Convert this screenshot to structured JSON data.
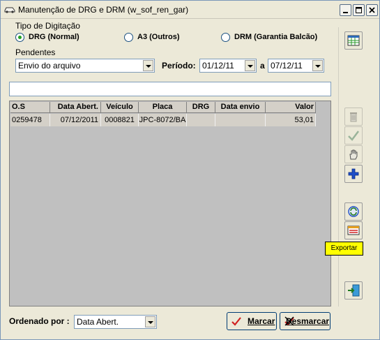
{
  "window": {
    "title": "Manutenção de DRG e DRM (w_sof_ren_gar)"
  },
  "tipo_digitacao": {
    "label": "Tipo de Digitação",
    "options": [
      {
        "label": "DRG (Normal)",
        "selected": true
      },
      {
        "label": "A3 (Outros)",
        "selected": false
      },
      {
        "label": "DRM (Garantia Balcão)",
        "selected": false
      }
    ]
  },
  "pendentes": {
    "label": "Pendentes",
    "value": "Envio do arquivo"
  },
  "periodo": {
    "label": "Período:",
    "from": "01/12/11",
    "separator": "a",
    "to": "07/12/11"
  },
  "grid": {
    "columns": [
      "O.S",
      "Data Abert.",
      "Veículo",
      "Placa",
      "DRG",
      "Data envio",
      "Valor"
    ],
    "rows": [
      [
        "0259478",
        "07/12/2011",
        "0008821",
        "JPC-8072/BA",
        "",
        "",
        "53,01"
      ]
    ]
  },
  "side_icons": [
    "spreadsheet-icon",
    "trash-icon",
    "check-icon",
    "hand-icon",
    "plus-icon",
    "refresh-icon",
    "export-icon",
    "exit-door-icon"
  ],
  "tooltip": "Exportar",
  "ordenado": {
    "label": "Ordenado por :",
    "value": "Data Abert."
  },
  "buttons": {
    "marcar": "Marcar",
    "desmarcar": "Desmarcar"
  },
  "colors": {
    "window_bg": "#ece9d8",
    "tooltip_bg": "#ffff00",
    "grid_bg": "#c0c0c0",
    "radio_selected": "#21a121"
  }
}
